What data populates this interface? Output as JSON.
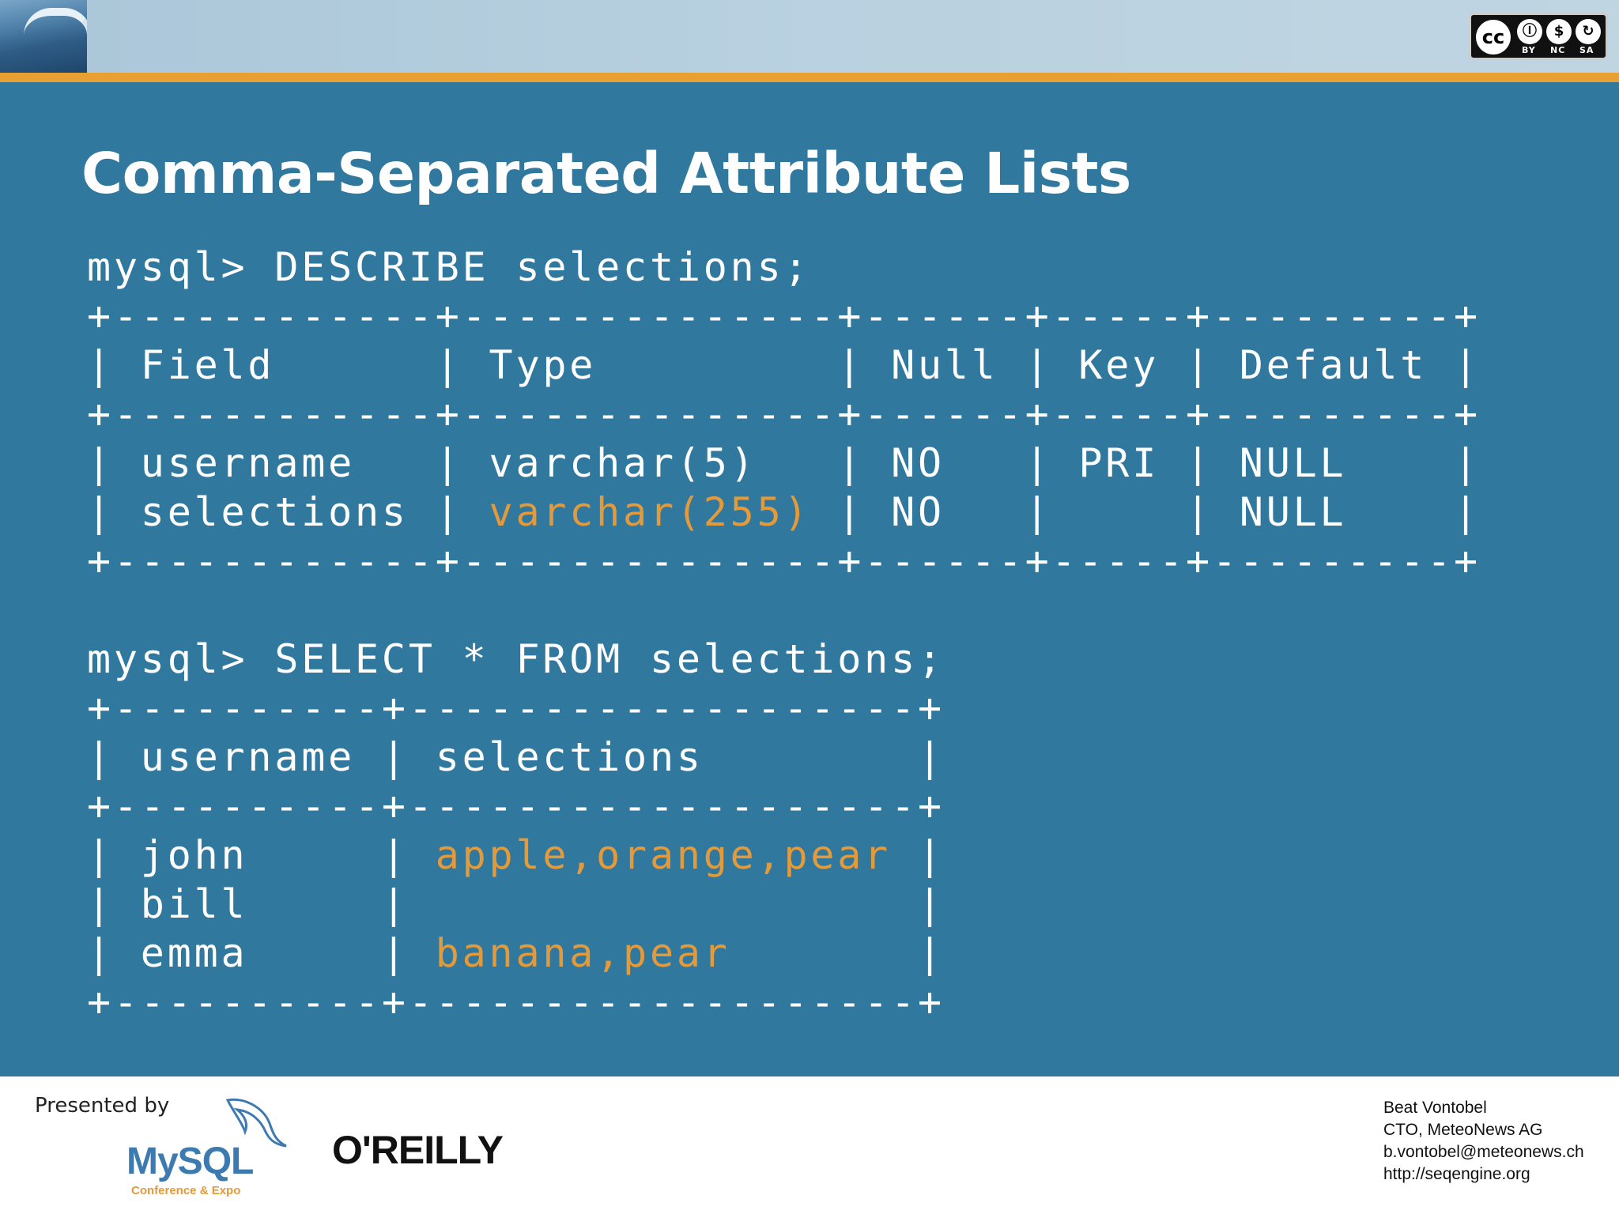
{
  "header": {
    "license_labels": [
      "BY",
      "NC",
      "SA"
    ],
    "cc_text": "cc"
  },
  "slide": {
    "title": "Comma-Separated Attribute Lists"
  },
  "describe_block": {
    "prompt": "mysql> DESCRIBE selections;",
    "border": "+------------+--------------+------+-----+---------+",
    "header_row": "| Field      | Type         | Null | Key | Default |",
    "row1": "| username   | varchar(5)   | NO   | PRI | NULL    |",
    "row2_start": "| selections | ",
    "row2_highlight": "varchar(255)",
    "row2_end": " | NO   |     | NULL    |"
  },
  "select_block": {
    "prompt": "mysql> SELECT * FROM selections;",
    "border": "+----------+-------------------+",
    "header_row": "| username | selections        |",
    "row1_start": "| john     | ",
    "row1_highlight": "apple,orange,pear",
    "row1_end": " |",
    "row2": "| bill     |                   |",
    "row3_start": "| emma     | ",
    "row3_highlight": "banana,pear",
    "row3_end": "       |"
  },
  "footer": {
    "presented_by": "Presented by",
    "mysql_logo_text": "MySQL",
    "mysql_logo_subtext": "Conference & Expo",
    "oreilly_logo_text": "O'REILLY",
    "presenter": {
      "name": "Beat Vontobel",
      "role": "CTO, MeteoNews AG",
      "email": "b.vontobel@meteonews.ch",
      "url": "http://seqengine.org"
    }
  },
  "colors": {
    "background": "#31789f",
    "accent_orange": "#e39a3b",
    "rule_orange": "#e7a031"
  }
}
